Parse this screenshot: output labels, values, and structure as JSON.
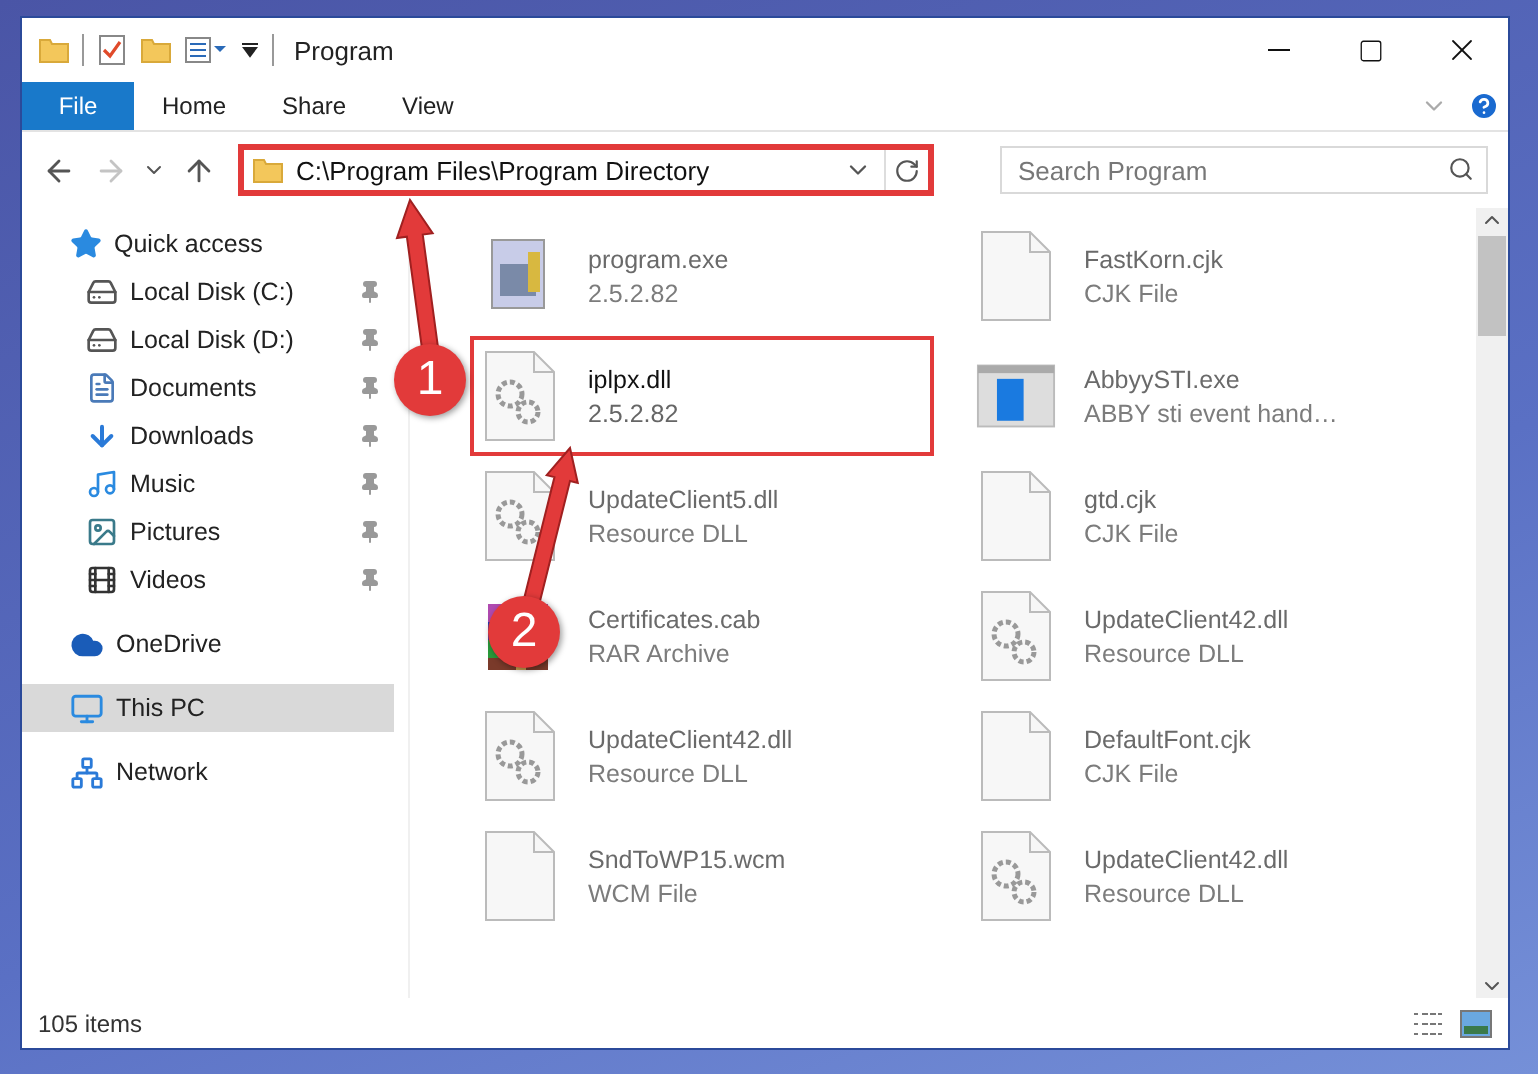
{
  "window": {
    "title": "Program"
  },
  "ribbon_tabs": [
    {
      "label": "File",
      "kind": "menu"
    },
    {
      "label": "Home",
      "kind": "tab"
    },
    {
      "label": "Share",
      "kind": "tab"
    },
    {
      "label": "View",
      "kind": "tab"
    }
  ],
  "nav_buttons": [
    {
      "kind": "back",
      "disabled": false
    },
    {
      "kind": "forward",
      "disabled": true
    },
    {
      "kind": "recent",
      "disabled": false
    },
    {
      "kind": "up",
      "disabled": false
    }
  ],
  "address": {
    "path": "C:\\Program Files\\Program Directory",
    "highlighted": true
  },
  "search": {
    "placeholder": "Search Program"
  },
  "sidebar": {
    "items": [
      {
        "label": "Quick access",
        "kind": "star",
        "selected": false,
        "children": [
          {
            "label": "Local Disk (C:)",
            "kind": "drive",
            "selected": false,
            "pinned": true
          },
          {
            "label": "Local Disk (D:)",
            "kind": "drive",
            "selected": false,
            "pinned": true
          },
          {
            "label": "Documents",
            "kind": "documents",
            "selected": false,
            "pinned": true
          },
          {
            "label": "Downloads",
            "kind": "downloads",
            "selected": false,
            "pinned": true
          },
          {
            "label": "Music",
            "kind": "music",
            "selected": false,
            "pinned": true
          },
          {
            "label": "Pictures",
            "kind": "pictures",
            "selected": false,
            "pinned": true
          },
          {
            "label": "Videos",
            "kind": "videos",
            "selected": false,
            "pinned": true
          }
        ]
      },
      {
        "label": "OneDrive",
        "kind": "cloud",
        "selected": false
      },
      {
        "label": "This PC",
        "kind": "computer",
        "selected": true
      },
      {
        "label": "Network",
        "kind": "network",
        "selected": false
      }
    ]
  },
  "files": [
    {
      "name": "program.exe",
      "detail": "2.5.2.82",
      "kind": "application",
      "highlighted": false,
      "faded": true
    },
    {
      "name": "FastKorn.cjk",
      "detail": "CJK File",
      "kind": "document",
      "highlighted": false,
      "faded": true
    },
    {
      "name": "iplpx.dll",
      "detail": "2.5.2.82",
      "kind": "settings",
      "highlighted": true,
      "faded": false
    },
    {
      "name": "AbbyySTI.exe",
      "detail": "ABBY sti event hand…",
      "kind": "window",
      "highlighted": false,
      "faded": true
    },
    {
      "name": "UpdateClient5.dll",
      "detail": "Resource DLL",
      "kind": "settings",
      "highlighted": false,
      "faded": true
    },
    {
      "name": "gtd.cjk",
      "detail": "CJK File",
      "kind": "document",
      "highlighted": false,
      "faded": true
    },
    {
      "name": "Certificates.cab",
      "detail": "RAR Archive",
      "kind": "archive",
      "highlighted": false,
      "faded": true
    },
    {
      "name": "UpdateClient42.dll",
      "detail": "Resource DLL",
      "kind": "settings",
      "highlighted": false,
      "faded": true
    },
    {
      "name": "UpdateClient42.dll",
      "detail": "Resource DLL",
      "kind": "settings",
      "highlighted": false,
      "faded": true
    },
    {
      "name": "DefaultFont.cjk",
      "detail": "CJK File",
      "kind": "document",
      "highlighted": false,
      "faded": true
    },
    {
      "name": "SndToWP15.wcm",
      "detail": "WCM File",
      "kind": "document",
      "highlighted": false,
      "faded": true
    },
    {
      "name": "UpdateClient42.dll",
      "detail": "Resource DLL",
      "kind": "settings",
      "highlighted": false,
      "faded": true
    }
  ],
  "status_bar": {
    "count": "105 items"
  },
  "annotations": [
    {
      "number": "1"
    },
    {
      "number": "2"
    }
  ]
}
